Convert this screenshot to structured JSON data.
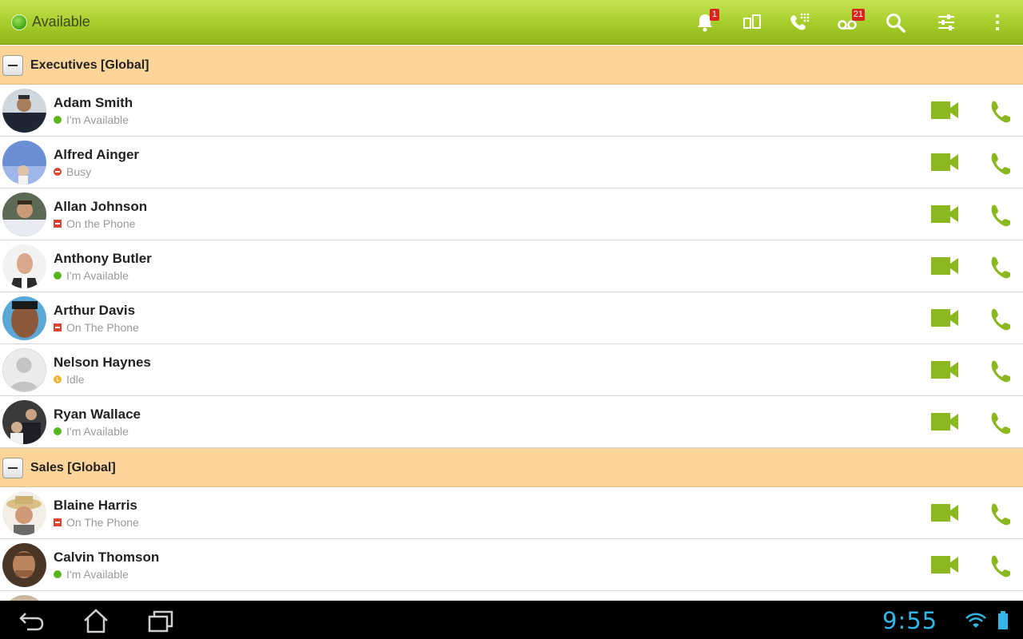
{
  "status": {
    "label": "Available",
    "color": "#4caf1a"
  },
  "toolbar": {
    "icons": [
      "bell-icon",
      "devices-icon",
      "dialpad-icon",
      "voicemail-icon",
      "search-icon",
      "settings-sliders-icon",
      "overflow-menu-icon"
    ],
    "notifications_badge": "1",
    "voicemail_badge": "21"
  },
  "groups": [
    {
      "title": "Executives [Global]",
      "contacts": [
        {
          "name": "Adam Smith",
          "status": "I'm Available",
          "status_type": "available"
        },
        {
          "name": "Alfred Ainger",
          "status": "Busy",
          "status_type": "busy"
        },
        {
          "name": "Allan Johnson",
          "status": "On the Phone",
          "status_type": "phone"
        },
        {
          "name": "Anthony Butler",
          "status": "I'm Available",
          "status_type": "available"
        },
        {
          "name": "Arthur Davis",
          "status": "On The Phone",
          "status_type": "phone"
        },
        {
          "name": "Nelson Haynes",
          "status": "Idle",
          "status_type": "idle"
        },
        {
          "name": "Ryan Wallace",
          "status": "I'm Available",
          "status_type": "available"
        }
      ]
    },
    {
      "title": "Sales [Global]",
      "contacts": [
        {
          "name": "Blaine Harris",
          "status": "On The Phone",
          "status_type": "phone"
        },
        {
          "name": "Calvin Thomson",
          "status": "I'm Available",
          "status_type": "available"
        }
      ]
    }
  ],
  "colors": {
    "accent": "#8cb81f",
    "group_header": "#fdd499",
    "clock": "#33b5e5"
  },
  "system": {
    "time": "9:55"
  }
}
